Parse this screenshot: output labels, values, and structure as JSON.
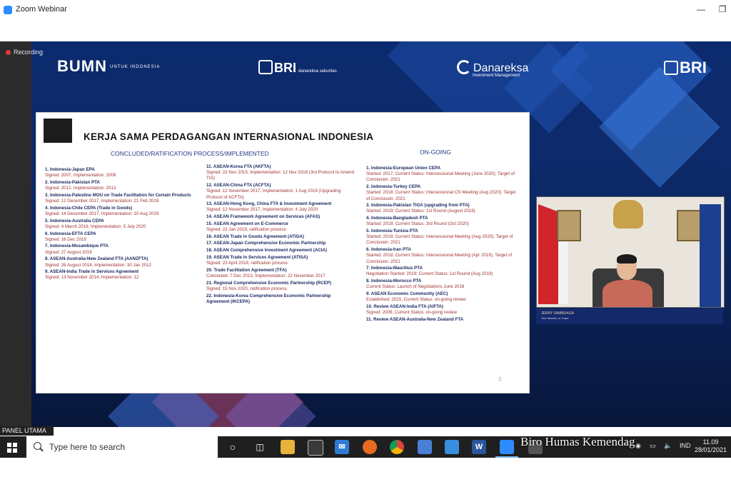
{
  "window": {
    "title": "Zoom Webinar"
  },
  "recording": {
    "label": "Recording"
  },
  "logos": {
    "bumn": "BUMN",
    "bumn_sub": "UNTUK INDONESIA",
    "bri_danareksa": "BRI",
    "bri_danareksa_sub": "danareksa sekuritas",
    "danareksa": "Danareksa",
    "danareksa_sub": "Investment Management",
    "bri": "BRI"
  },
  "slide": {
    "title": "KERJA SAMA PERDAGANGAN INTERNASIONAL INDONESIA",
    "section_left": "CONCLUDED/RATIFICATION PROCESS/IMPLEMENTED",
    "section_right": "ON-GOING",
    "page_number": "5",
    "col1": [
      "1. Indonesia-Japan EPA",
      "Signed: 2007, Implementation: 2008",
      "2. Indonesia-Pakistan PTA",
      "Signed: 2012, Implementation: 2013",
      "3. Indonesia-Palestine MOU on Trade Facilitation for Certain Products",
      "Signed: 12 December 2017, Implementation: 21 Feb 2019",
      "4. Indonesia-Chile CEPA (Trade in Goods)",
      "Signed: 14 December 2017, Implementation: 10 Aug 2019",
      "5. Indonesia-Australia CEPA",
      "Signed: 4 March 2019, Implementation: 5 July 2020",
      "6. Indonesia-EFTA CEPA",
      "Signed: 16 Dec 2018",
      "7. Indonesia-Mozambique PTA",
      "Signed: 27 August 2019",
      "8. ASEAN-Australia-New Zealand FTA (AANZFTA)",
      "Signed: 26 August 2014, Implementation: 30 Jan 2012",
      "9. ASEAN-India Trade in Services Agreement",
      "Signed: 13 November 2014, Implementation: 12"
    ],
    "col2": [
      "11. ASEAN-Korea FTA (AKFTA)",
      "Signed: 22 Nov 2015, Implementation: 12 Nov 2018 (3rd Protocol to Amend TIG)",
      "12. ASEAN-China FTA (ACFTA)",
      "Signed: 12 November 2017, Implementation: 1 Aug 2019 (Upgrading Protocol of ACFTA)",
      "13. ASEAN-Hong Kong, China FTA & Investment Agreement",
      "Signed: 12 November 2017, Implementation: 4 July 2020",
      "14. ASEAN Framework Agreement on Services (AFAS)",
      "15. ASEAN Agreement on E-Commerce",
      "Signed: 22 Jan 2019, ratification process",
      "16. ASEAN Trade in Goods Agreement (ATIGA)",
      "17. ASEAN-Japan Comprehensive Economic Partnership",
      "18. ASEAN Comprehensive Investment Agreement (ACIA)",
      "19. ASEAN Trade in Services Agreement (ATISA)",
      "Signed: 23 April 2019, ratification process",
      "20. Trade Facilitation Agreement (TFA)",
      "Concluded: 7 Dec 2013, Implementation: 22 November 2017",
      "21. Regional Comprehensive Economic Partnership (RCEP)",
      "Signed: 15 Nov 2020, ratification process",
      "22. Indonesia-Korea Comprehensive Economic Partnership Agreement (IKCEPA)"
    ],
    "col3": [
      "1. Indonesia-European Union CEPA",
      "Started: 2017; Current Status: Intersessional Meeting (June 2020); Target of Conclusion: 2021",
      "2. Indonesia-Turkey CEPA",
      "Started: 2018; Current Status: Intersessional CN Meeting (Aug 2020); Target of Conclusion: 2021",
      "3. Indonesia-Pakistan TIGA (upgrading from PTA)",
      "Started: 2019; Current Status: 1st Round (August 2019)",
      "4. Indonesia-Bangladesh PTA",
      "Started: 2018; Current Status: 3rd Round (Oct 2020)",
      "5. Indonesia-Tunisia PTA",
      "Started: 2019; Current Status: Intersessional Meeting (Aug 2020); Target of Conclusion: 2021",
      "6. Indonesia-Iran PTA",
      "Started: 2018; Current Status: Intersessional Meeting (Apr 2019); Target of Conclusion: 2021",
      "7. Indonesia-Mauritius PTA",
      "Negotiation Started: 2019; Current Status: 1st Round (Aug 2019)",
      "8. Indonesia-Morocco PTA",
      "Current Status: Launch of Negotiations June 2018",
      "9. ASEAN Economic Community (AEC)",
      "Established: 2015, Current Status: on-going review",
      "10. Review ASEAN-India FTA (AIFTA)",
      "Signed: 2009, Current Status: on-going review",
      "11. Review ASEAN-Australia-New Zealand FTA"
    ]
  },
  "video": {
    "name_line": "JERRY SAMBUAGA",
    "title_line": "Vice Minister of Trade"
  },
  "panel_label": "PANEL UTAMA",
  "taskbar": {
    "search_placeholder": "Type here to search",
    "apps": [
      "cortana-icon",
      "task-view-icon",
      "file-explorer-icon",
      "store-icon",
      "mail-icon",
      "firefox-icon",
      "chrome-icon",
      "app-icon",
      "photos-icon",
      "word-icon",
      "zoom-icon"
    ],
    "tray_lang": "IND",
    "time": "11.09",
    "date": "28/01/2021"
  },
  "watermark": "Biro Humas Kemendag"
}
